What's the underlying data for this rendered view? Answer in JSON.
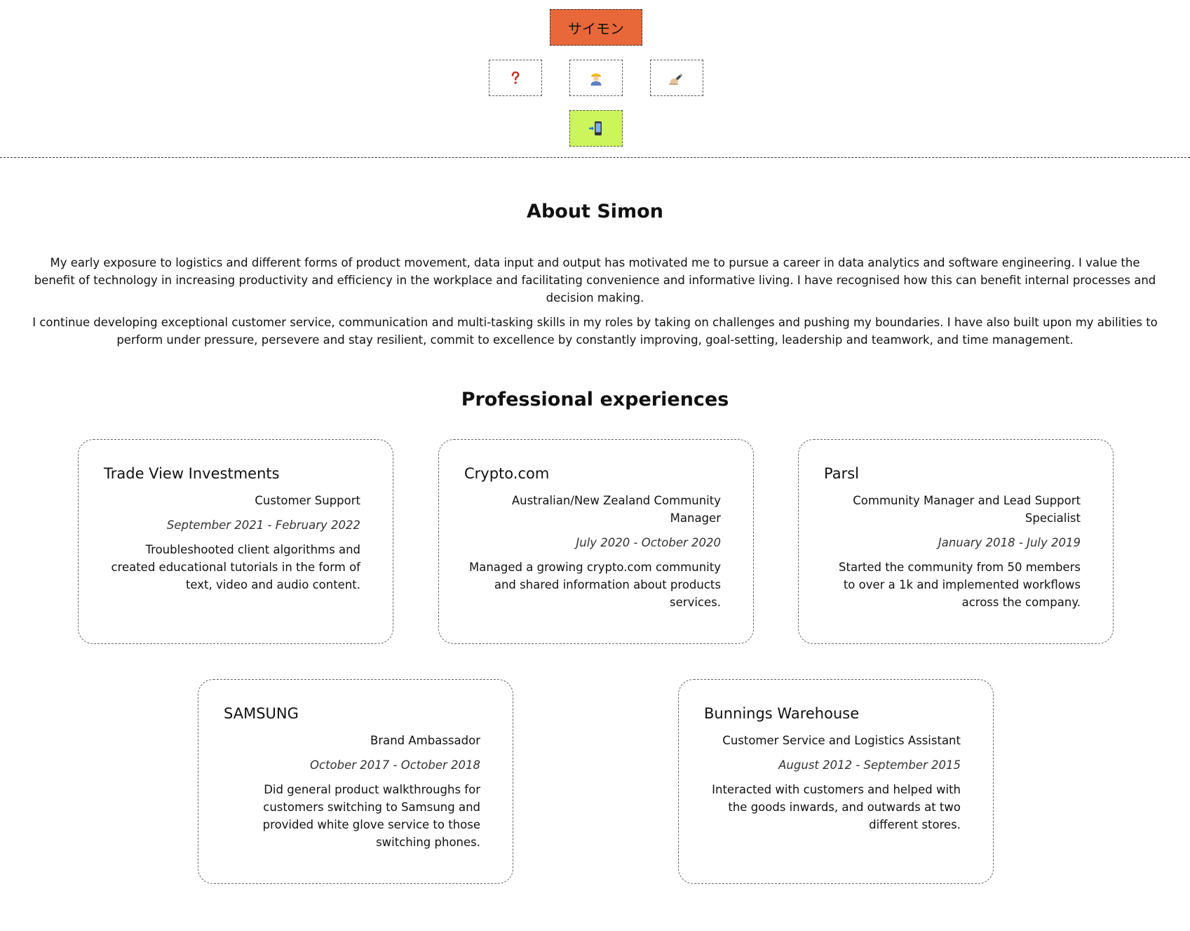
{
  "header": {
    "name_label": "サイモン",
    "nav": [
      {
        "icon": "question-mark-icon"
      },
      {
        "icon": "worker-icon"
      },
      {
        "icon": "writing-hand-icon"
      }
    ],
    "contact": {
      "icon": "phone-incoming-icon"
    },
    "accent_color": "#e8683a",
    "contact_color": "#ccf55c"
  },
  "about": {
    "title": "About Simon",
    "paragraphs": [
      "My early exposure to logistics and different forms of product movement, data input and output has motivated me to pursue a career in data analytics and software engineering. I value the benefit of technology in increasing productivity and efficiency in the workplace and facilitating convenience and informative living. I have recognised how this can benefit internal processes and decision making.",
      "I continue developing exceptional customer service, communication and multi-tasking skills in my roles by taking on challenges and pushing my boundaries. I have also built upon my abilities to perform under pressure, persevere and stay resilient, commit to excellence by constantly improving, goal-setting, leadership and teamwork, and time management."
    ]
  },
  "experience": {
    "title": "Professional experiences",
    "items": [
      {
        "company": "Trade View Investments",
        "role": "Customer Support",
        "date": "September 2021 - February 2022",
        "desc": "Troubleshooted client algorithms and created educational tutorials in the form of text, video and audio content."
      },
      {
        "company": "Crypto.com",
        "role": "Australian/New Zealand Community Manager",
        "date": "July 2020 - October 2020",
        "desc": "Managed a growing crypto.com community and shared information about products services."
      },
      {
        "company": "Parsl",
        "role": "Community Manager and Lead Support Specialist",
        "date": "January 2018 - July 2019",
        "desc": "Started the community from 50 members to over a 1k and implemented workflows across the company."
      },
      {
        "company": "SAMSUNG",
        "role": "Brand Ambassador",
        "date": "October 2017 - October 2018",
        "desc": "Did general product walkthroughs for customers switching to Samsung and provided white glove service to those switching phones."
      },
      {
        "company": "Bunnings Warehouse",
        "role": "Customer Service and Logistics Assistant",
        "date": "August 2012 - September 2015",
        "desc": "Interacted with customers and helped with the goods inwards, and outwards at two different stores."
      }
    ]
  }
}
